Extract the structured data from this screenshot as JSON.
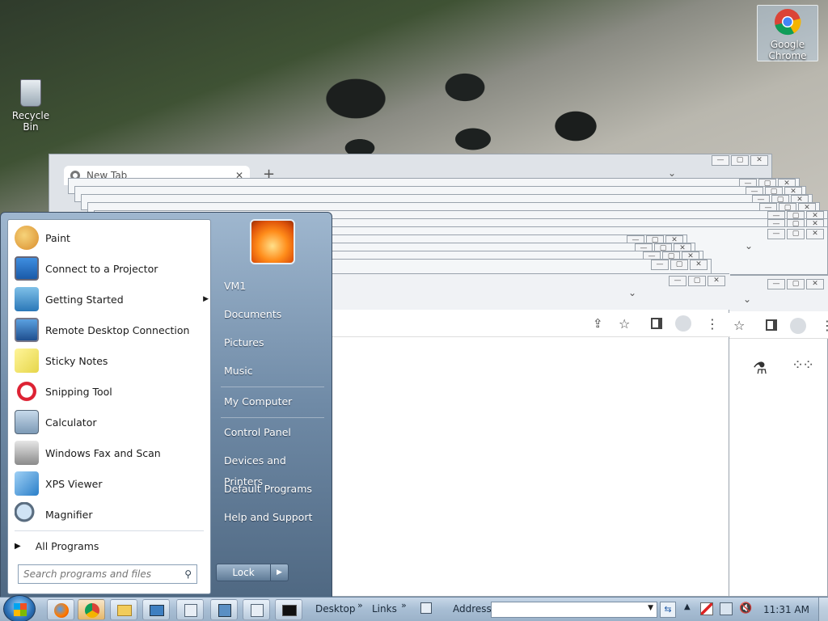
{
  "desktop": {
    "recycle_bin_label": "Recycle Bin",
    "chrome_label": "Google Chrome"
  },
  "browser": {
    "tab_title": "New Tab"
  },
  "start_menu": {
    "programs": [
      {
        "label": "Paint",
        "icon": "paint-icon"
      },
      {
        "label": "Connect to a Projector",
        "icon": "projector-icon"
      },
      {
        "label": "Getting Started",
        "icon": "getting-started-icon",
        "has_submenu": true
      },
      {
        "label": "Remote Desktop Connection",
        "icon": "remote-desktop-icon"
      },
      {
        "label": "Sticky Notes",
        "icon": "sticky-notes-icon"
      },
      {
        "label": "Snipping Tool",
        "icon": "snipping-tool-icon"
      },
      {
        "label": "Calculator",
        "icon": "calculator-icon"
      },
      {
        "label": "Windows Fax and Scan",
        "icon": "fax-scan-icon"
      },
      {
        "label": "XPS Viewer",
        "icon": "xps-viewer-icon"
      },
      {
        "label": "Magnifier",
        "icon": "magnifier-icon"
      }
    ],
    "all_programs": "All Programs",
    "search_placeholder": "Search programs and files",
    "right_items": [
      "VM1",
      "Documents",
      "Pictures",
      "Music",
      "My Computer",
      "Control Panel",
      "Devices and Printers",
      "Default Programs",
      "Help and Support"
    ],
    "lock_label": "Lock"
  },
  "taskbar": {
    "toolbar_desktop": "Desktop",
    "toolbar_links": "Links",
    "address_label": "Address",
    "address_value": "",
    "clock": "11:31 AM"
  },
  "colors": {
    "start_menu_accent": "#6f8aa6",
    "taskbar": "#a8bed4"
  }
}
